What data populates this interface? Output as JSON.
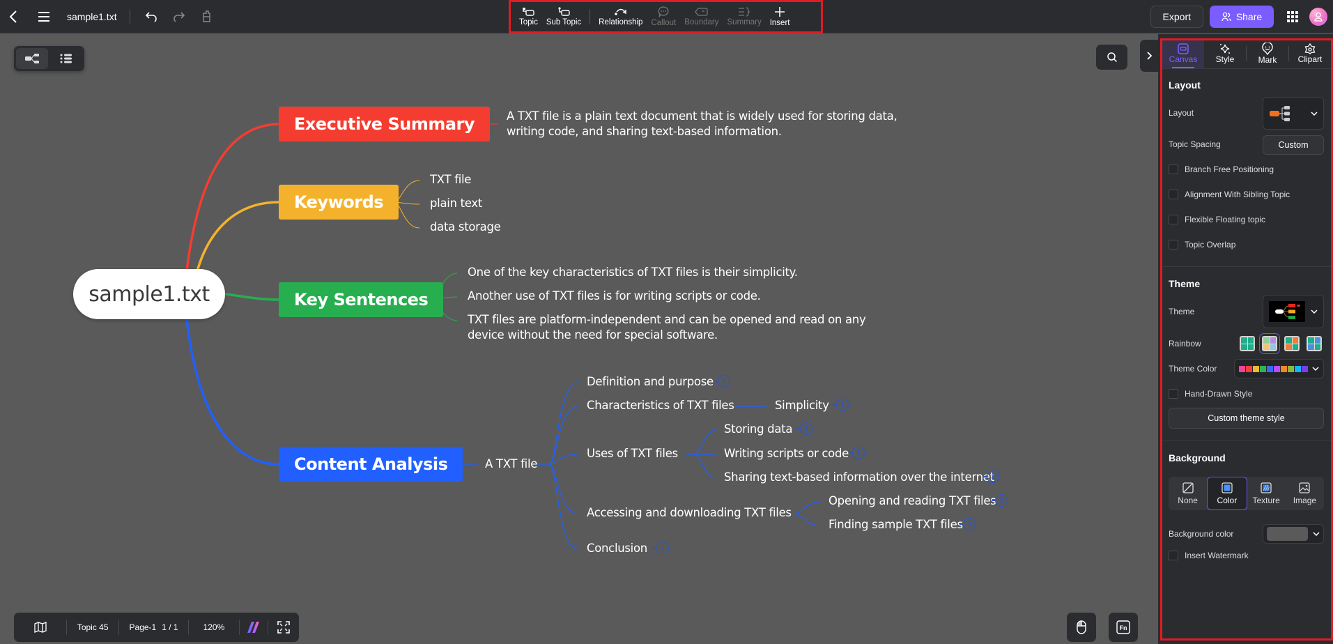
{
  "header": {
    "file_title": "sample1.txt",
    "tools": [
      {
        "label": "Topic",
        "icon": "topic-icon",
        "enabled": true
      },
      {
        "label": "Sub Topic",
        "icon": "subtopic-icon",
        "enabled": true
      },
      {
        "label": "Relationship",
        "icon": "relationship-icon",
        "enabled": true
      },
      {
        "label": "Callout",
        "icon": "callout-icon",
        "enabled": false
      },
      {
        "label": "Boundary",
        "icon": "boundary-icon",
        "enabled": false
      },
      {
        "label": "Summary",
        "icon": "summary-icon",
        "enabled": false
      },
      {
        "label": "Insert",
        "icon": "plus-icon",
        "enabled": true
      }
    ],
    "export_label": "Export",
    "share_label": "Share"
  },
  "mindmap": {
    "root": "sample1.txt",
    "branches": [
      {
        "label": "Executive Summary",
        "color": "#f43d30",
        "children": [
          "A TXT file is a plain text document that is widely used for storing data, writing code, and sharing text-based information."
        ]
      },
      {
        "label": "Keywords",
        "color": "#f4b22c",
        "children": [
          "TXT file",
          "plain text",
          "data storage"
        ]
      },
      {
        "label": "Key Sentences",
        "color": "#27ae4f",
        "children": [
          "One of the key characteristics of TXT files is their simplicity.",
          "Another use of TXT files is for writing scripts or code.",
          "TXT files are platform-independent and can be opened and read on any device without the need for special software."
        ]
      },
      {
        "label": "Content Analysis",
        "color": "#2160ff",
        "child": "A TXT file",
        "items": [
          {
            "label": "Definition and purpose",
            "badge": "2"
          },
          {
            "label": "Characteristics of TXT files",
            "child": {
              "label": "Simplicity",
              "badge": "3"
            }
          },
          {
            "label": "Uses of TXT files",
            "children": [
              {
                "label": "Storing data",
                "badge": "3"
              },
              {
                "label": "Writing scripts or code",
                "badge": "3"
              },
              {
                "label": "Sharing text-based information over the internet",
                "badge": "3"
              }
            ]
          },
          {
            "label": "Accessing and downloading TXT files",
            "children": [
              {
                "label": "Opening and reading TXT files",
                "badge": "2"
              },
              {
                "label": "Finding sample TXT files",
                "badge": "3"
              }
            ]
          },
          {
            "label": "Conclusion",
            "badge": "2"
          }
        ]
      }
    ]
  },
  "statusbar": {
    "topic_count": "Topic 45",
    "page": "Page-1",
    "page_count": "1 / 1",
    "zoom": "120%"
  },
  "panel": {
    "tabs": [
      {
        "label": "Canvas",
        "active": true
      },
      {
        "label": "Style",
        "active": false
      },
      {
        "label": "Mark",
        "active": false
      },
      {
        "label": "Clipart",
        "active": false
      }
    ],
    "layout": {
      "section_title": "Layout",
      "layout_label": "Layout",
      "topic_spacing_label": "Topic Spacing",
      "topic_spacing_value": "Custom",
      "checkboxes": [
        {
          "label": "Branch Free Positioning",
          "checked": false
        },
        {
          "label": "Alignment With Sibling Topic",
          "checked": false
        },
        {
          "label": "Flexible Floating topic",
          "checked": false
        },
        {
          "label": "Topic Overlap",
          "checked": false
        }
      ]
    },
    "theme": {
      "section_title": "Theme",
      "theme_label": "Theme",
      "rainbow_label": "Rainbow",
      "rainbow_selected": 1,
      "theme_color_label": "Theme Color",
      "theme_colors": [
        "#f0439a",
        "#f2403a",
        "#f5b82c",
        "#2db357",
        "#2f6ef5",
        "#b84df5",
        "#f5822c",
        "#8bb83d",
        "#16b4f0",
        "#7b3cf0"
      ],
      "hand_drawn_label": "Hand-Drawn Style",
      "hand_drawn_checked": false,
      "custom_theme_label": "Custom theme style"
    },
    "background": {
      "section_title": "Background",
      "options": [
        {
          "label": "None",
          "active": false
        },
        {
          "label": "Color",
          "active": true
        },
        {
          "label": "Texture",
          "active": false
        },
        {
          "label": "Image",
          "active": false
        }
      ],
      "bg_color_label": "Background color",
      "bg_color_value": "#5a5a5a",
      "watermark_label": "Insert Watermark",
      "watermark_checked": false
    }
  }
}
